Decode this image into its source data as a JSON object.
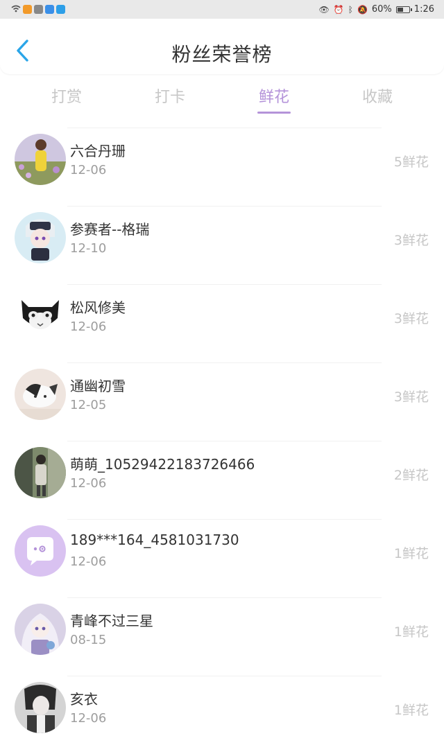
{
  "status_bar": {
    "battery": "60%",
    "time": "1:26",
    "battery_level": 0.6
  },
  "header": {
    "title": "粉丝荣誉榜"
  },
  "tabs": [
    {
      "label": "打赏",
      "active": false
    },
    {
      "label": "打卡",
      "active": false
    },
    {
      "label": "鲜花",
      "active": true
    },
    {
      "label": "收藏",
      "active": false
    }
  ],
  "list": [
    {
      "name": "六合丹珊",
      "date": "12-06",
      "count": "5鲜花",
      "avatar": "girl-in-flower-field"
    },
    {
      "name": "参赛者--格瑞",
      "date": "12-10",
      "count": "3鲜花",
      "avatar": "anime-character"
    },
    {
      "name": "松风修美",
      "date": "12-06",
      "count": "3鲜花",
      "avatar": "black-white-cat"
    },
    {
      "name": "通幽初雪",
      "date": "12-05",
      "count": "3鲜花",
      "avatar": "lying-cat"
    },
    {
      "name": "萌萌_10529422183726466",
      "date": "12-06",
      "count": "2鲜花",
      "avatar": "street-photo"
    },
    {
      "name": "189***164_4581031730",
      "date": "12-06",
      "count": "1鲜花",
      "avatar": "default-chat-bubble"
    },
    {
      "name": "青峰不过三星",
      "date": "08-15",
      "count": "1鲜花",
      "avatar": "anime-girl"
    },
    {
      "name": "亥衣",
      "date": "12-06",
      "count": "1鲜花",
      "avatar": "blurry-figure"
    }
  ],
  "colors": {
    "accent": "#b493d9",
    "tab_inactive": "#c7c7c7",
    "text": "#333333",
    "muted": "#9d9d9d",
    "back": "#2aa5e8"
  }
}
